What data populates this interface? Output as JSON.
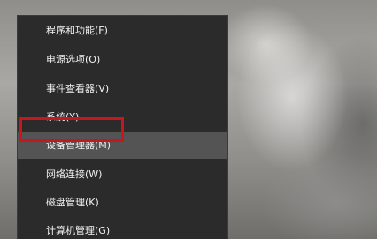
{
  "context_menu": {
    "items": [
      {
        "label": "程序和功能(F)"
      },
      {
        "label": "电源选项(O)"
      },
      {
        "label": "事件查看器(V)"
      },
      {
        "label": "系统(Y)"
      },
      {
        "label": "设备管理器(M)",
        "highlighted": true
      },
      {
        "label": "网络连接(W)"
      },
      {
        "label": "磁盘管理(K)"
      },
      {
        "label": "计算机管理(G)"
      }
    ]
  },
  "colors": {
    "menu_background": "#2b2b2b",
    "hover_background": "#545454",
    "annotation_red": "#c7161e",
    "text": "#f2f2f2"
  }
}
